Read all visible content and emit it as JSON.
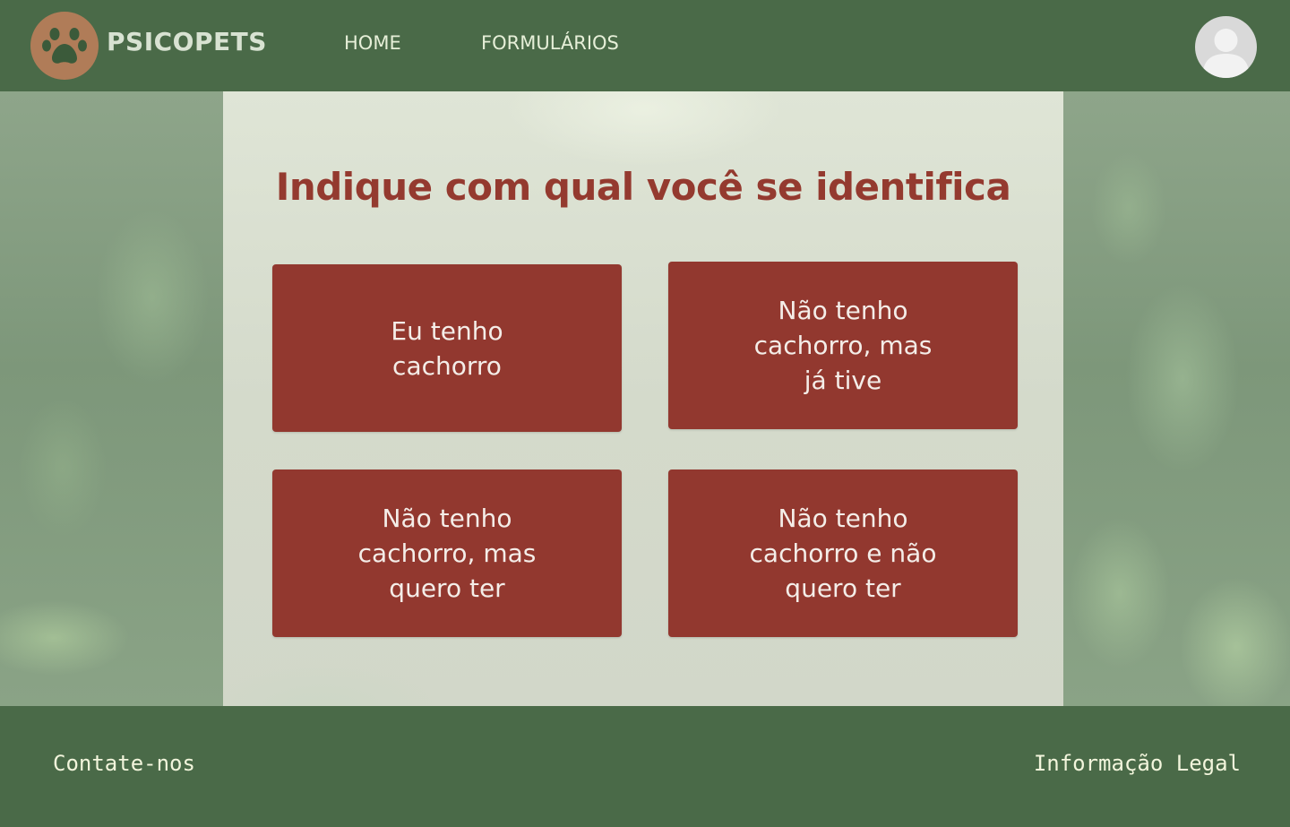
{
  "header": {
    "brand": "PSICOPETS",
    "logo_icon": "paw-icon",
    "nav": {
      "home": "HOME",
      "forms": "FORMULÁRIOS"
    },
    "avatar_icon": "user-avatar-icon"
  },
  "main": {
    "title": "Indique com qual você se identifica",
    "options": [
      {
        "label": "Eu tenho\ncachorro"
      },
      {
        "label": "Não tenho\ncachorro, mas\njá tive"
      },
      {
        "label": "Não tenho\ncachorro, mas\nquero ter"
      },
      {
        "label": "Não tenho\ncachorro e não\nquero ter"
      }
    ]
  },
  "footer": {
    "contact": "Contate-nos",
    "legal": "Informação Legal"
  },
  "colors": {
    "header_bg": "#4a6a48",
    "accent": "#92382f",
    "title": "#943a2f",
    "logo_circle": "#b07c58"
  }
}
